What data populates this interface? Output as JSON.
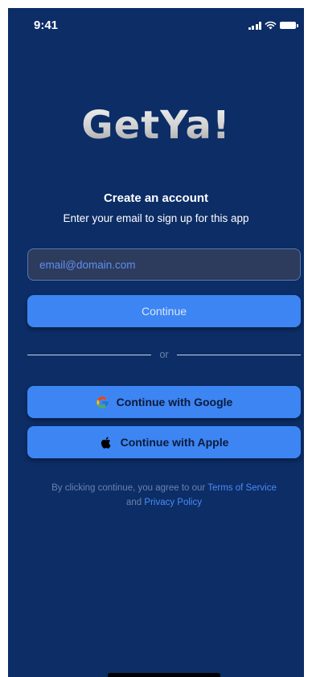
{
  "status_bar": {
    "time": "9:41",
    "icons": [
      "signal-icon",
      "wifi-icon",
      "battery-icon"
    ]
  },
  "app": {
    "logo_text": "GetYa!"
  },
  "signup": {
    "heading": "Create an account",
    "subheading": "Enter your email to sign up for this app",
    "email_placeholder": "email@domain.com",
    "continue_label": "Continue",
    "divider_text": "or",
    "google_label": "Continue with Google",
    "apple_label": "Continue with Apple"
  },
  "terms": {
    "prefix": "By clicking continue, you agree to our ",
    "terms_link": "Terms of Service",
    "middle": "and ",
    "privacy_link": "Privacy Policy"
  },
  "colors": {
    "background": "#0c2d66",
    "button": "#3d85f3",
    "input_bg": "#2d3b5c",
    "link": "#4a8cf6"
  }
}
